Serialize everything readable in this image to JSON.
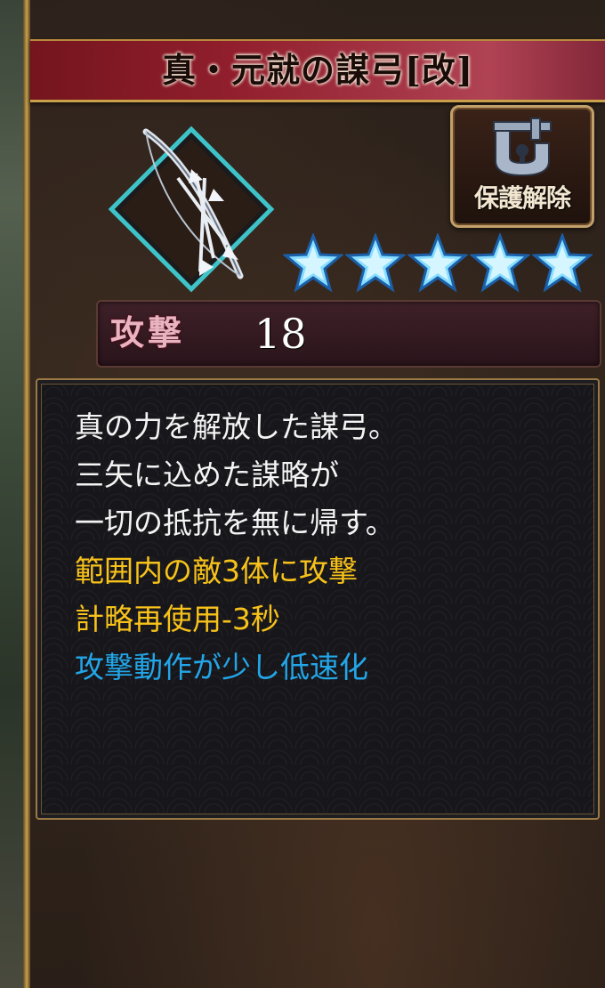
{
  "item": {
    "title": "真・元就の謀弓[改]",
    "weapon_icon": "bow-and-arrows-icon",
    "lock_button": {
      "label": "保護解除",
      "icon": "padlock-icon"
    },
    "rarity_stars": 5,
    "stat": {
      "label": "攻撃",
      "value": "18"
    },
    "description": [
      {
        "text": "真の力を解放した謀弓。",
        "color": "#f4f4f4"
      },
      {
        "text": "三矢に込めた謀略が",
        "color": "#f4f4f4"
      },
      {
        "text": "一切の抵抗を無に帰す。",
        "color": "#f4f4f4"
      },
      {
        "text": "範囲内の敵3体に攻撃",
        "color": "#f7c21a"
      },
      {
        "text": "計略再使用-3秒",
        "color": "#f7c21a"
      },
      {
        "text": "攻撃動作が少し低速化",
        "color": "#22a6e8"
      }
    ]
  },
  "colors": {
    "title_bar": "#96202d",
    "frame_gold": "#c9a14a",
    "star": "#7fd8ff",
    "effect_positive": "#f7c21a",
    "effect_negative": "#22a6e8"
  }
}
